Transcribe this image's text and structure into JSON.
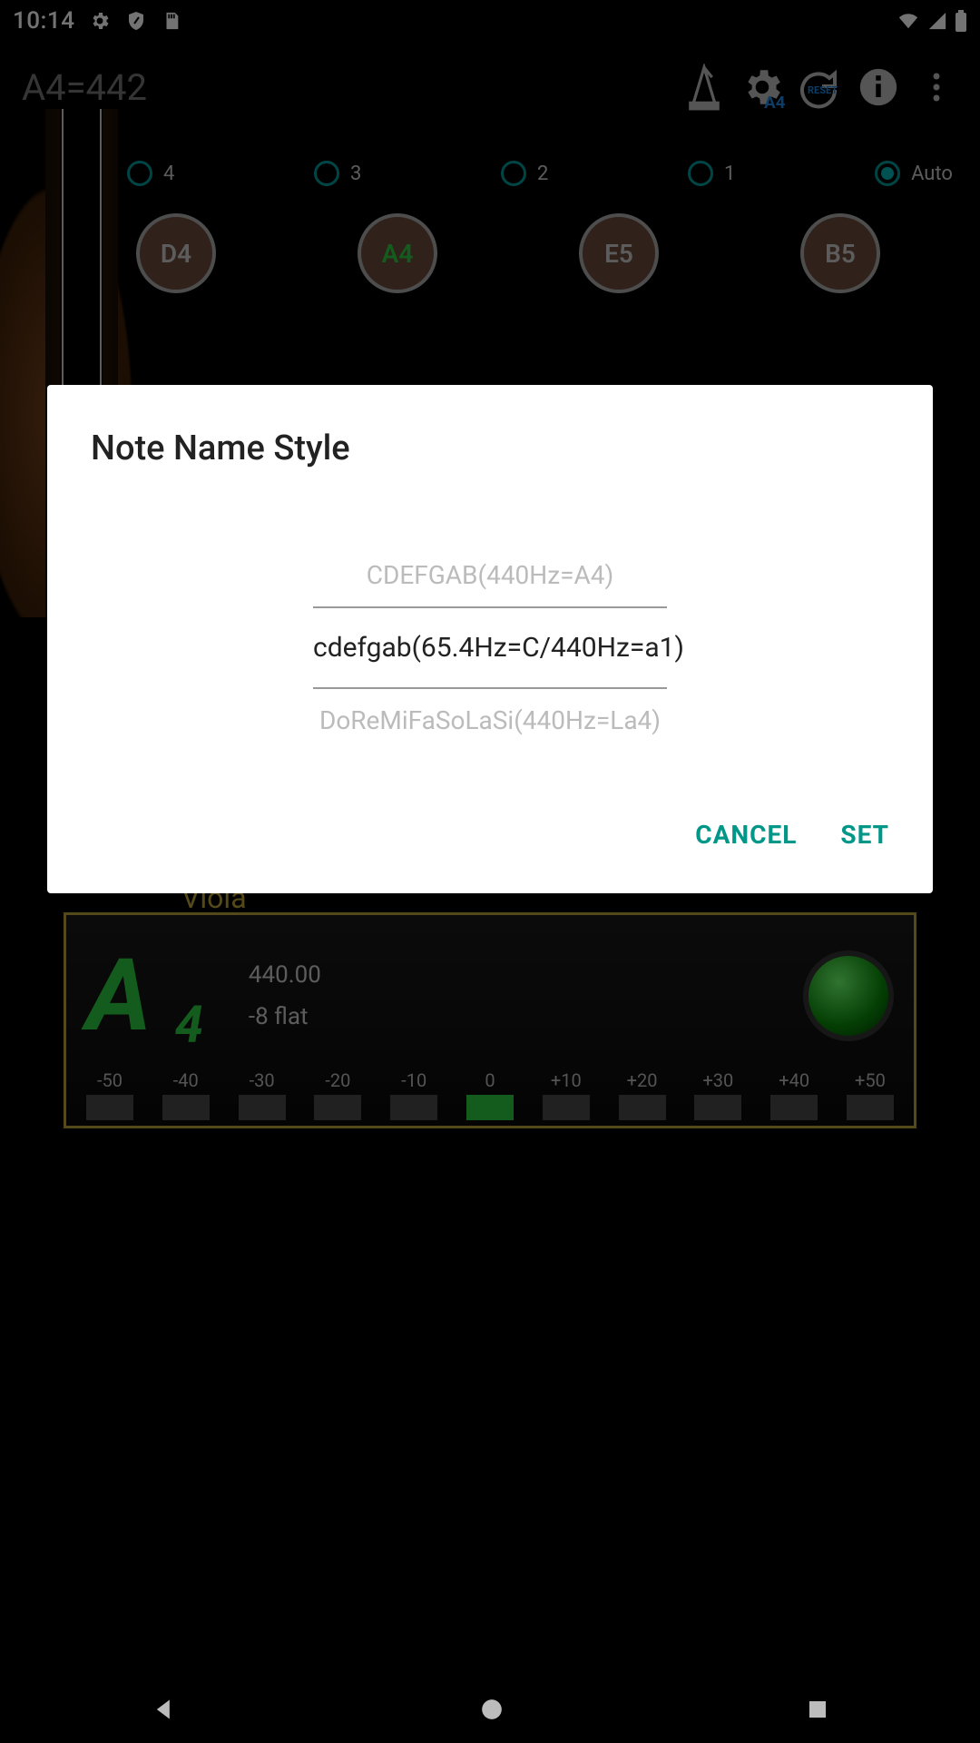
{
  "status": {
    "clock": "10:14"
  },
  "toolbar": {
    "a4": "A4=442",
    "reset_label": "RESET",
    "a4_badge": "A4"
  },
  "strings": {
    "items": [
      {
        "label": "4",
        "selected": false
      },
      {
        "label": "3",
        "selected": false
      },
      {
        "label": "2",
        "selected": false
      },
      {
        "label": "1",
        "selected": false
      },
      {
        "label": "Auto",
        "selected": true
      }
    ]
  },
  "notes": {
    "items": [
      {
        "label": "D4",
        "active": false
      },
      {
        "label": "A4",
        "active": true
      },
      {
        "label": "E5",
        "active": false
      },
      {
        "label": "B5",
        "active": false
      }
    ],
    "cents_marker": "-100"
  },
  "instrument": "Viola",
  "panel": {
    "note": "A",
    "octave": "4",
    "freq": "440.00",
    "deviation": "-8 flat",
    "scale": [
      "-50",
      "-40",
      "-30",
      "-20",
      "-10",
      "0",
      "+10",
      "+20",
      "+30",
      "+40",
      "+50"
    ],
    "active_index": 5
  },
  "dialog": {
    "title": "Note Name Style",
    "options": [
      "CDEFGAB(440Hz=A4)",
      "cdefgab(65.4Hz=C/440Hz=a1)",
      "DoReMiFaSoLaSi(440Hz=La4)"
    ],
    "selected_index": 1,
    "cancel": "CANCEL",
    "set": "SET"
  }
}
